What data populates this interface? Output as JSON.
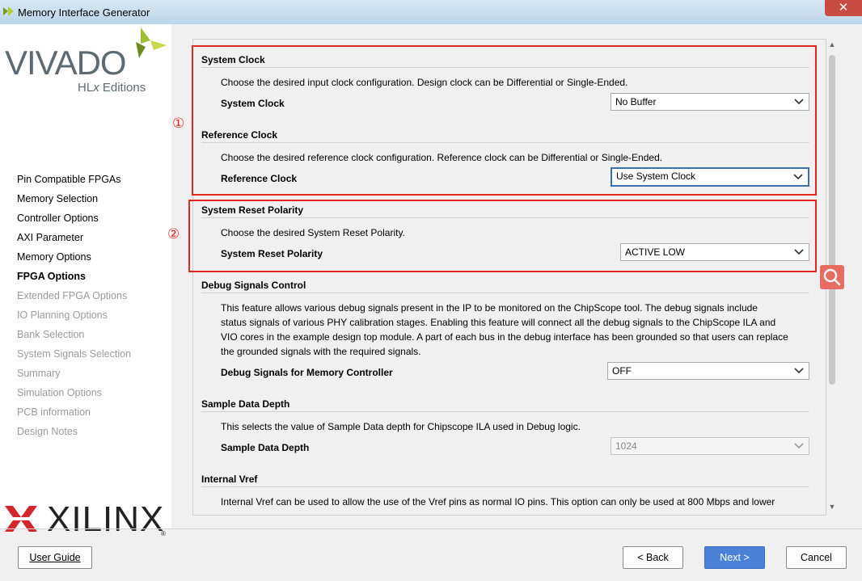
{
  "window": {
    "title": "Memory Interface Generator",
    "close_label": "✕"
  },
  "branding": {
    "vivado": "VIVADO",
    "vivado_sub_prefix": "HL",
    "vivado_sub_x": "x",
    "vivado_sub_suffix": " Editions",
    "xilinx": "XILINX",
    "registered": "®"
  },
  "nav": {
    "items": [
      {
        "label": "Pin Compatible FPGAs",
        "state": "normal"
      },
      {
        "label": "Memory Selection",
        "state": "normal"
      },
      {
        "label": "Controller Options",
        "state": "normal"
      },
      {
        "label": "AXI Parameter",
        "state": "normal"
      },
      {
        "label": "Memory Options",
        "state": "normal"
      },
      {
        "label": "FPGA Options",
        "state": "active"
      },
      {
        "label": "Extended FPGA Options",
        "state": "disabled"
      },
      {
        "label": "IO Planning Options",
        "state": "disabled"
      },
      {
        "label": "Bank Selection",
        "state": "disabled"
      },
      {
        "label": "System Signals Selection",
        "state": "disabled"
      },
      {
        "label": "Summary",
        "state": "disabled"
      },
      {
        "label": "Simulation Options",
        "state": "disabled"
      },
      {
        "label": "PCB information",
        "state": "disabled"
      },
      {
        "label": "Design Notes",
        "state": "disabled"
      }
    ]
  },
  "annotations": {
    "marker1": "①",
    "marker2": "②"
  },
  "sections": {
    "system_clock": {
      "title": "System Clock",
      "desc": "Choose the desired input clock configuration. Design clock can be Differential or Single-Ended.",
      "label": "System Clock",
      "value": "No Buffer"
    },
    "reference_clock": {
      "title": "Reference Clock",
      "desc": "Choose the desired reference clock configuration. Reference clock can be Differential or Single-Ended.",
      "label": "Reference Clock",
      "value": "Use System Clock"
    },
    "reset_polarity": {
      "title": "System Reset Polarity",
      "desc": "Choose the desired System Reset Polarity.",
      "label": "System Reset Polarity",
      "value": "ACTIVE LOW"
    },
    "debug": {
      "title": "Debug Signals Control",
      "desc_lines": [
        "This feature allows various debug signals present in the IP to be monitored on the ChipScope tool. The debug signals include",
        "status signals of various PHY calibration stages. Enabling this feature will connect all the debug signals to the ChipScope ILA and",
        "VIO cores in the example design top module. A part of each bus in the debug interface has been grounded so that users can replace",
        "the grounded signals with the required signals."
      ],
      "label": "Debug Signals for Memory Controller",
      "value": "OFF"
    },
    "sample_depth": {
      "title": "Sample Data Depth",
      "desc": "This selects the value of Sample Data depth for Chipscope ILA used in Debug logic.",
      "label": "Sample Data Depth",
      "value": "1024"
    },
    "internal_vref": {
      "title": "Internal Vref",
      "desc": "Internal Vref can be used to allow the use of the Vref pins as normal IO pins. This option can only be used at 800 Mbps and lower"
    }
  },
  "buttons": {
    "user_guide": "User Guide",
    "back": "< Back",
    "next": "Next >",
    "cancel": "Cancel"
  },
  "colors": {
    "annotation_red": "#e2271f",
    "primary_blue": "#4b82d8",
    "focus_blue": "#3c6fb6"
  }
}
